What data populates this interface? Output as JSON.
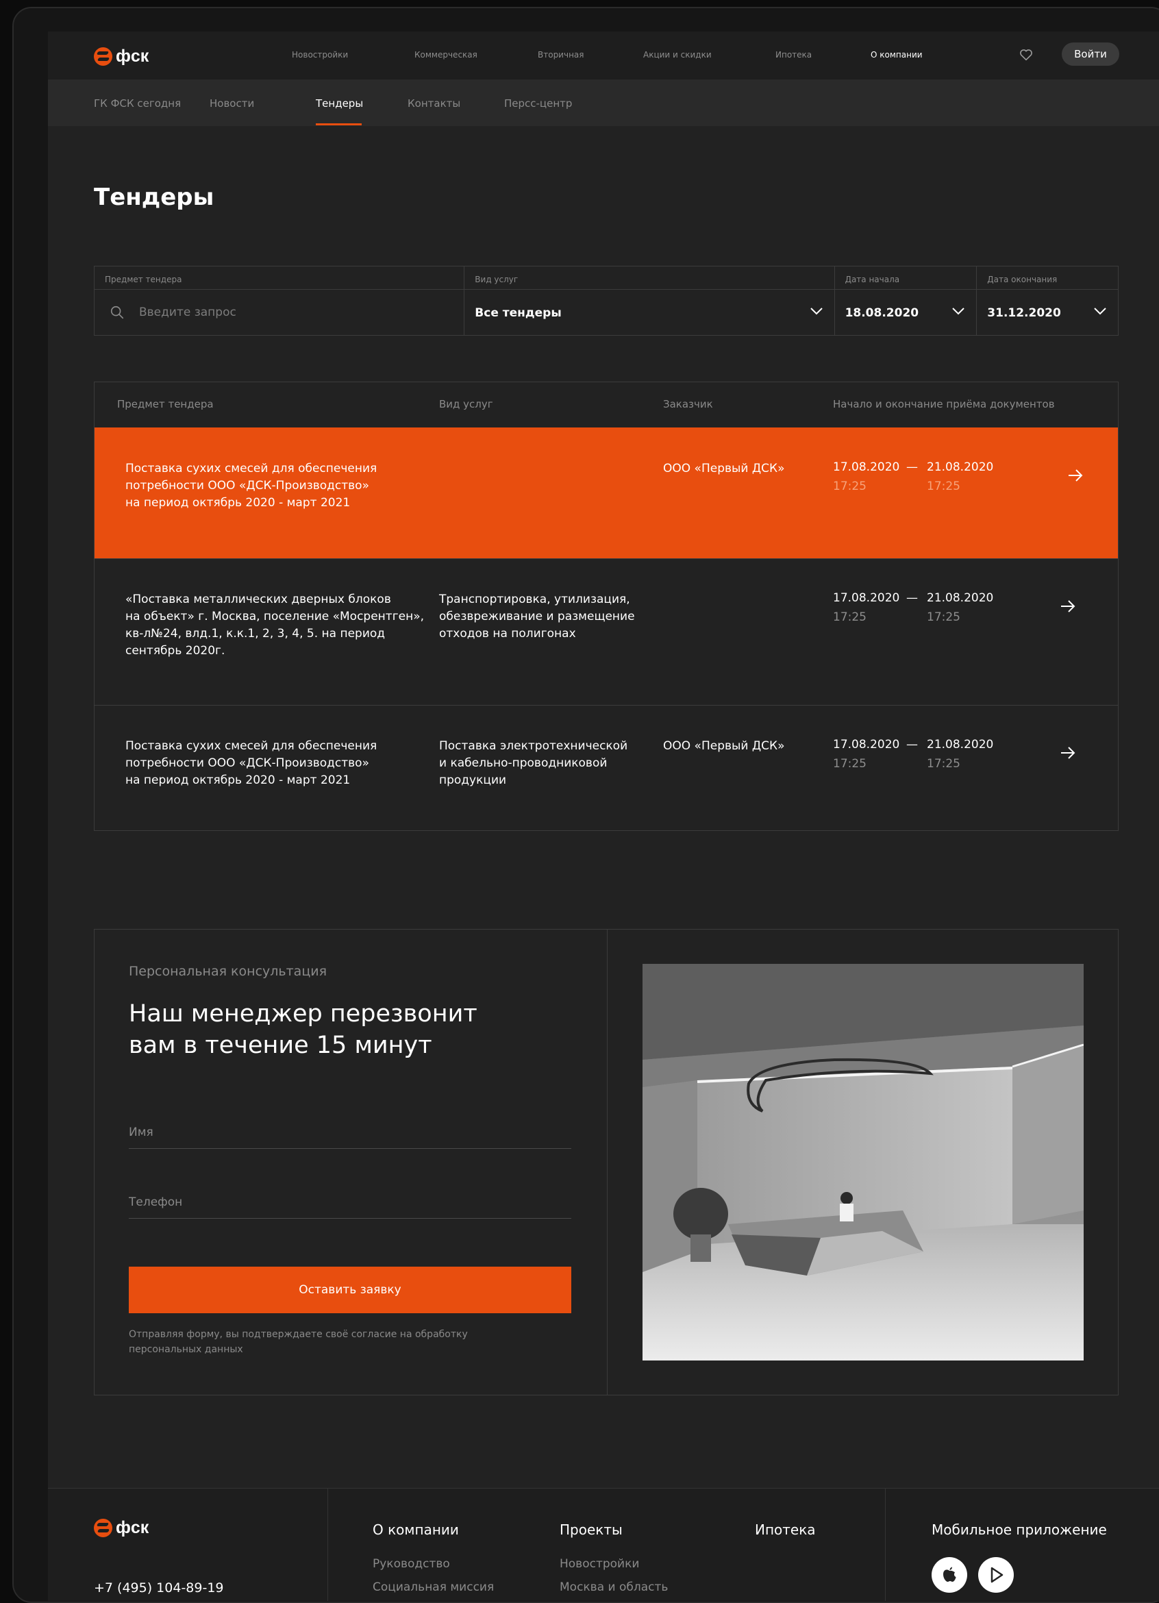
{
  "header": {
    "logo": "фск",
    "nav": [
      "Новостройки",
      "Коммерческая",
      "Вторичная",
      "Акции и скидки",
      "Ипотека",
      "О компании"
    ],
    "active_nav": "О компании",
    "login_label": "Войти"
  },
  "subnav": {
    "items": [
      "ГК ФСК сегодня",
      "Новости",
      "Тендеры",
      "Контакты",
      "Персс-центр"
    ],
    "active": "Тендеры"
  },
  "page_title": "Тендеры",
  "filters": {
    "subject": {
      "label": "Предмет тендера",
      "placeholder": "Введите запрос"
    },
    "service": {
      "label": "Вид услуг",
      "value": "Все тендеры"
    },
    "start": {
      "label": "Дата начала",
      "value": "18.08.2020"
    },
    "end": {
      "label": "Дата окончания",
      "value": "31.12.2020"
    }
  },
  "table": {
    "headers": [
      "Предмет тендера",
      "Вид услуг",
      "Заказчик",
      "Начало  и окончание приёма документов"
    ],
    "rows": [
      {
        "subject": "Поставка сухих смесей для обеспечения\nпотребности ООО «ДСК-Производство»\nна период октябрь 2020 - март 2021",
        "service": "",
        "customer": "ООО «Первый ДСК»",
        "start_date": "17.08.2020",
        "start_time": "17:25",
        "end_date": "21.08.2020",
        "end_time": "17:25",
        "dash": "—",
        "highlighted": true
      },
      {
        "subject": "«Поставка металлических дверных блоков\nна объект» г. Москва, поселение «Мосрентген»,\nкв-л№24, влд.1, к.к.1, 2, 3, 4, 5. на период\nсентябрь 2020г.",
        "service": "Транспортировка, утилизация,\nобезвреживание и размещение\nотходов на полигонах",
        "customer": "",
        "start_date": "17.08.2020",
        "start_time": "17:25",
        "end_date": "21.08.2020",
        "end_time": "17:25",
        "dash": "—",
        "highlighted": false
      },
      {
        "subject": "Поставка сухих смесей для обеспечения\nпотребности ООО «ДСК-Производство»\nна период октябрь 2020 - март 2021",
        "service": "Поставка электротехнической\nи кабельно-проводниковой\nпродукции",
        "customer": "ООО «Первый ДСК»",
        "start_date": "17.08.2020",
        "start_time": "17:25",
        "end_date": "21.08.2020",
        "end_time": "17:25",
        "dash": "—",
        "highlighted": false
      }
    ]
  },
  "consultation": {
    "kicker": "Персональная консультация",
    "title": "Наш менеджер перезвонит\nвам в течение 15 минут",
    "name_placeholder": "Имя",
    "phone_placeholder": "Телефон",
    "submit_label": "Оставить заявку",
    "note": "Отправляя форму, вы подтверждаете своё согласие на обработку\nперсональных данных"
  },
  "footer": {
    "logo": "фск",
    "phone": "+7 (495) 104-89-19",
    "columns": [
      {
        "title": "О компании",
        "links": [
          "Руководство",
          "Социальная миссия"
        ]
      },
      {
        "title": "Проекты",
        "links": [
          "Новостройки",
          "Москва и область"
        ]
      },
      {
        "title": "Ипотека",
        "links": []
      }
    ],
    "app_title": "Мобильное приложение"
  },
  "colors": {
    "accent": "#e84e0f",
    "bg": "#222222",
    "border": "#3c3c3c",
    "muted": "#8a8a8a"
  }
}
